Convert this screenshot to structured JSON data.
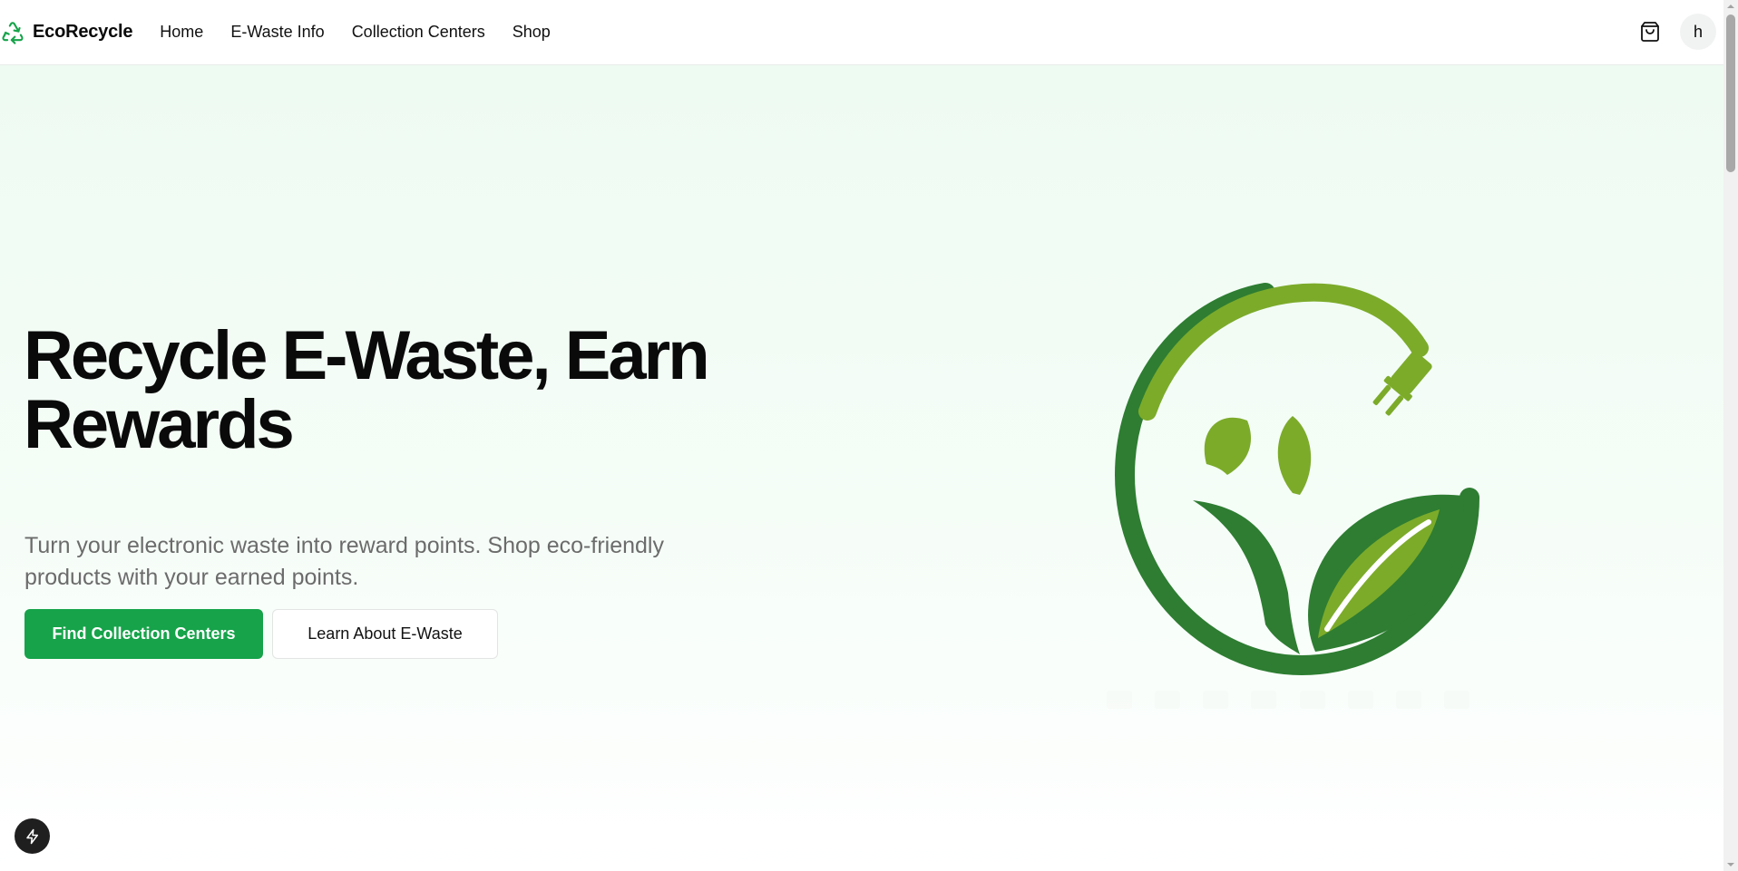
{
  "header": {
    "brand": "EcoRecycle",
    "nav": [
      "Home",
      "E-Waste Info",
      "Collection Centers",
      "Shop"
    ],
    "avatar_initial": "h"
  },
  "hero": {
    "title": "Recycle E-Waste, Earn Rewards",
    "subtitle": "Turn your electronic waste into reward points. Shop eco-friendly products with your earned points.",
    "primary_button": "Find Collection Centers",
    "secondary_button": "Learn About E-Waste"
  },
  "icons": [
    "recycle-icon",
    "shopping-bag-icon",
    "lightning-icon",
    "eco-plug-leaf-logo"
  ],
  "colors": {
    "accent": "#16a34a",
    "logo_dark_green": "#2e7d32",
    "logo_light_green": "#7cab2a",
    "hero_background": "#eefbf2"
  }
}
